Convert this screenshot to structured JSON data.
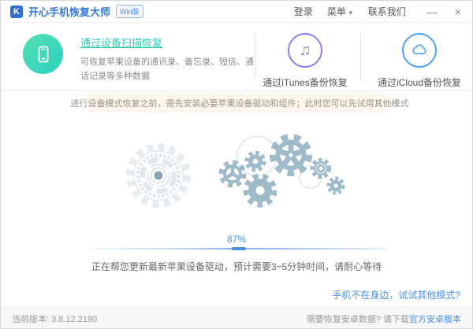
{
  "header": {
    "logo_letter": "K",
    "app_title": "开心手机恢复大师",
    "version_badge": "Win版",
    "nav": {
      "login": "登录",
      "menu": "菜单",
      "contact": "联系我们"
    },
    "window_controls": {
      "minimize": "—",
      "close": "×"
    }
  },
  "modes": {
    "device_scan": {
      "title": "通过设备扫描恢复",
      "description": "可恢复苹果设备的通讯录、备忘录、短信、通话记录等多种数据",
      "icon": "smartphone-icon"
    },
    "itunes": {
      "label": "通过iTunes备份恢复",
      "icon": "music-note-icon"
    },
    "icloud": {
      "label": "通过iCloud备份恢复",
      "icon": "cloud-icon"
    }
  },
  "notice": {
    "icon": "megaphone-icon",
    "text": "进行设备模式恢复之前，需先安装必要苹果设备驱动和组件；此时您可以先试用其他模式"
  },
  "progress": {
    "percent_label": "87%",
    "percent_value": 87,
    "status_text": "正在帮您更新最新苹果设备驱动，预计需要3~5分钟时间，请耐心等待"
  },
  "links": {
    "try_other_mode": "手机不在身边，试试其他模式?"
  },
  "statusbar": {
    "version": "当前版本: 3.8.12.2190",
    "android_prompt": "需要恢复安卓数据? 请下载",
    "android_link": "官方安卓版本"
  },
  "colors": {
    "brand_blue": "#3577d4",
    "link_blue": "#4a90e2",
    "teal_green": "#2bcabb",
    "itunes_purple": "#8d7bf0",
    "icloud_blue": "#4aa0f5",
    "notice_bg": "#fdf6ec",
    "notice_orange": "#f0953f",
    "gear_blue_gray": "#9fbbca"
  }
}
